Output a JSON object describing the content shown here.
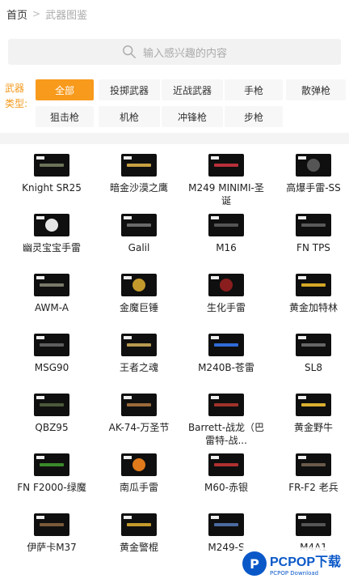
{
  "breadcrumb": {
    "home": "首页",
    "separator": ">",
    "current": "武器图鉴"
  },
  "search": {
    "placeholder": "输入感兴趣的内容"
  },
  "filter": {
    "label": "武器类型:",
    "chips": [
      "全部",
      "投掷武器",
      "近战武器",
      "手枪",
      "散弹枪",
      "狙击枪",
      "机枪",
      "冲锋枪",
      "步枪"
    ],
    "active": "全部",
    "accent": "#f89a1c"
  },
  "weapons": [
    {
      "name": "Knight SR25",
      "color": "#6b7358"
    },
    {
      "name": "暗金沙漠之鹰",
      "color": "#c8a043"
    },
    {
      "name": "M249 MINIMI-圣诞",
      "color": "#b8303a"
    },
    {
      "name": "高爆手雷-SS",
      "color": "#555555"
    },
    {
      "name": "幽灵宝宝手雷",
      "color": "#e6e6e6"
    },
    {
      "name": "Galil",
      "color": "#6a6a6a"
    },
    {
      "name": "M16",
      "color": "#555555"
    },
    {
      "name": "FN TPS",
      "color": "#5a5a5a"
    },
    {
      "name": "AWM-A",
      "color": "#7a7a6a"
    },
    {
      "name": "金魔巨锤",
      "color": "#c49a2c"
    },
    {
      "name": "生化手雷",
      "color": "#8a1e1e"
    },
    {
      "name": "黄金加特林",
      "color": "#d4a726"
    },
    {
      "name": "MSG90",
      "color": "#5e5e5e"
    },
    {
      "name": "王者之魂",
      "color": "#b89a50"
    },
    {
      "name": "M240B-苍雷",
      "color": "#2f6bd6"
    },
    {
      "name": "SL8",
      "color": "#666666"
    },
    {
      "name": "QBZ95",
      "color": "#4c5a3c"
    },
    {
      "name": "AK-74-万圣节",
      "color": "#9a6a3a"
    },
    {
      "name": "Barrett-战龙（巴雷特-战...",
      "color": "#a0322a"
    },
    {
      "name": "黄金野牛",
      "color": "#d9b030"
    },
    {
      "name": "FN F2000-绿魔",
      "color": "#3a8a2a"
    },
    {
      "name": "南瓜手雷",
      "color": "#e07a1a"
    },
    {
      "name": "M60-赤银",
      "color": "#b03030"
    },
    {
      "name": "FR-F2 老兵",
      "color": "#6a5a4a"
    },
    {
      "name": "伊萨卡M37",
      "color": "#7a5a3a"
    },
    {
      "name": "黄金警棍",
      "color": "#c49a2c"
    },
    {
      "name": "M249-S",
      "color": "#4a6aa0"
    },
    {
      "name": "M4A1",
      "color": "#555555"
    }
  ],
  "watermark": {
    "brand": "PCPOP下载",
    "sub": "PCPOP Download"
  }
}
